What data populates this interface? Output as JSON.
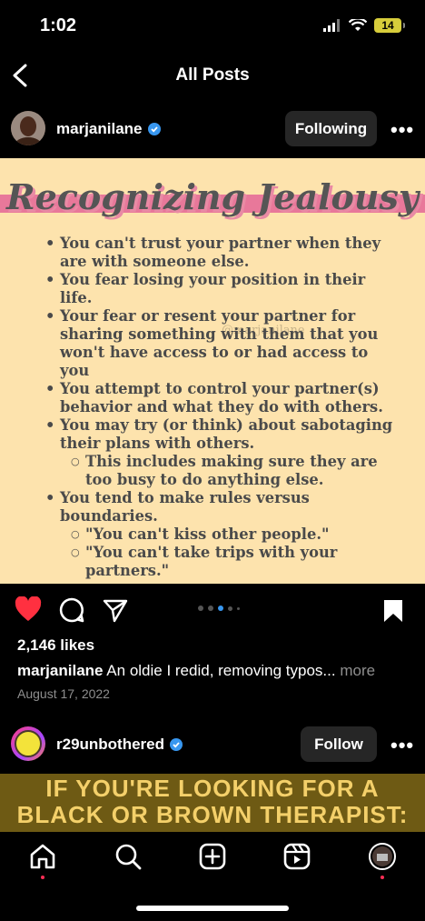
{
  "status": {
    "time": "1:02",
    "battery": "14"
  },
  "nav": {
    "title": "All Posts"
  },
  "post": {
    "username": "marjanilane",
    "follow_label": "Following",
    "more_label": "•••",
    "image": {
      "title": "Recognizing Jealousy",
      "watermark": "@marjanilane",
      "bullets": [
        "You can't trust your partner when they are with someone else.",
        "You fear losing your position in their life.",
        "Your fear or resent your partner for sharing something with them that you won't have access to or had access to you",
        "You attempt to control your partner(s) behavior and what they do with others.",
        "You may try (or think) about sabotaging their plans with others."
      ],
      "sub1": "This includes making sure they are too busy to do anything else.",
      "bullet_last": "You tend to make rules versus boundaries.",
      "sub2": [
        "\"You can't kiss other people.\"",
        "\"You can't take trips with your partners.\""
      ]
    },
    "likes": "2,146 likes",
    "caption_user": "marjanilane",
    "caption_text": "An oldie I redid, removing typos...",
    "caption_more": "more",
    "date": "August 17, 2022"
  },
  "next_post": {
    "username": "r29unbothered",
    "follow_label": "Follow",
    "more_label": "•••",
    "preview_line1": "IF YOU'RE LOOKING FOR A",
    "preview_line2": "BLACK OR BROWN THERAPIST:"
  },
  "tabs": [
    "home-icon",
    "search-icon",
    "create-icon",
    "reels-icon",
    "profile-icon"
  ],
  "colors": {
    "accent_blue": "#3897f0",
    "heart_red": "#ff3040",
    "image_bg": "#fde3ad",
    "banner_pink": "#e8789a"
  }
}
